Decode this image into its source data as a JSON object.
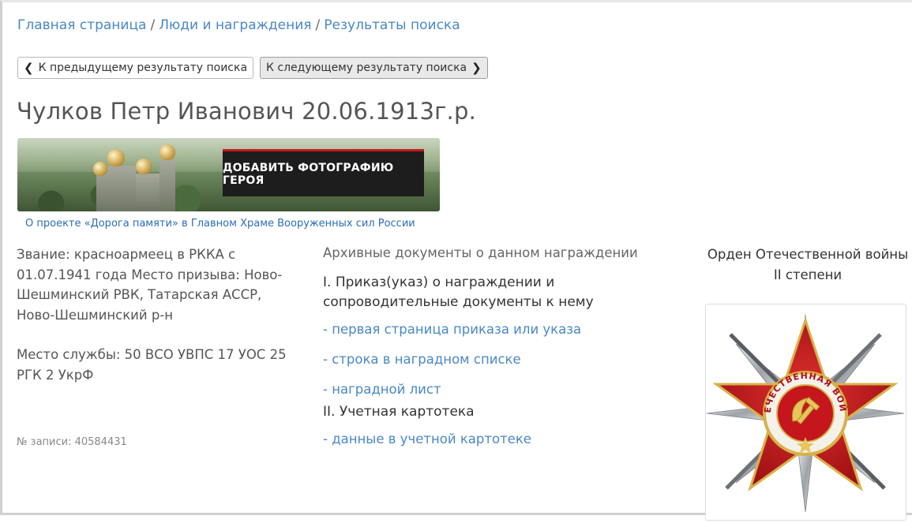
{
  "breadcrumb": [
    {
      "label": "Главная страница"
    },
    {
      "label": "Люди и награждения"
    },
    {
      "label": "Результаты поиска"
    }
  ],
  "breadcrumb_separator": "/",
  "nav": {
    "prev_label": "К предыдущему результату поиска",
    "next_label": "К следующему результату поиска",
    "prev_icon": "chevron-left-icon",
    "next_icon": "chevron-right-icon"
  },
  "person": {
    "title": "Чулков Петр Иванович 20.06.1913г.р.",
    "rank_info": "Звание: красноармеец в РККА с 01.07.1941 года Место призыва: Ново-Шешминский РВК, Татарская АССР, Ново-Шешминский р-н",
    "service_place": "Место службы: 50 ВСО УВПС 17 УОС 25 РГК 2 УкрФ",
    "record_no": "№ записи: 40584431"
  },
  "banner": {
    "cta_label": "ДОБАВИТЬ ФОТОГРАФИЮ ГЕРОЯ",
    "project_link": "О проекте «Дорога памяти» в Главном Храме Вооруженных сил России"
  },
  "archive": {
    "title": "Архивные документы о данном награждении",
    "section1_title": "I. Приказ(указ) о награждении и сопроводительные документы к нему",
    "section1_links": [
      {
        "label": "- первая страница приказа или указа"
      },
      {
        "label": "- строка в наградном списке"
      },
      {
        "label": "- наградной лист"
      }
    ],
    "section2_title": "II. Учетная картотека",
    "section2_links": [
      {
        "label": "- данные в учетной картотеке"
      }
    ]
  },
  "award": {
    "name": "Орден Отечественной войны II степени",
    "medal_text": "ОТЕЧЕСТВЕННАЯ ВОЙНА",
    "colors": {
      "star_red": "#c4161c",
      "silver": "#bfc3c8",
      "gold": "#d7b24a"
    }
  },
  "colors": {
    "link": "#4a87c7",
    "accent_red": "#c4161c"
  }
}
